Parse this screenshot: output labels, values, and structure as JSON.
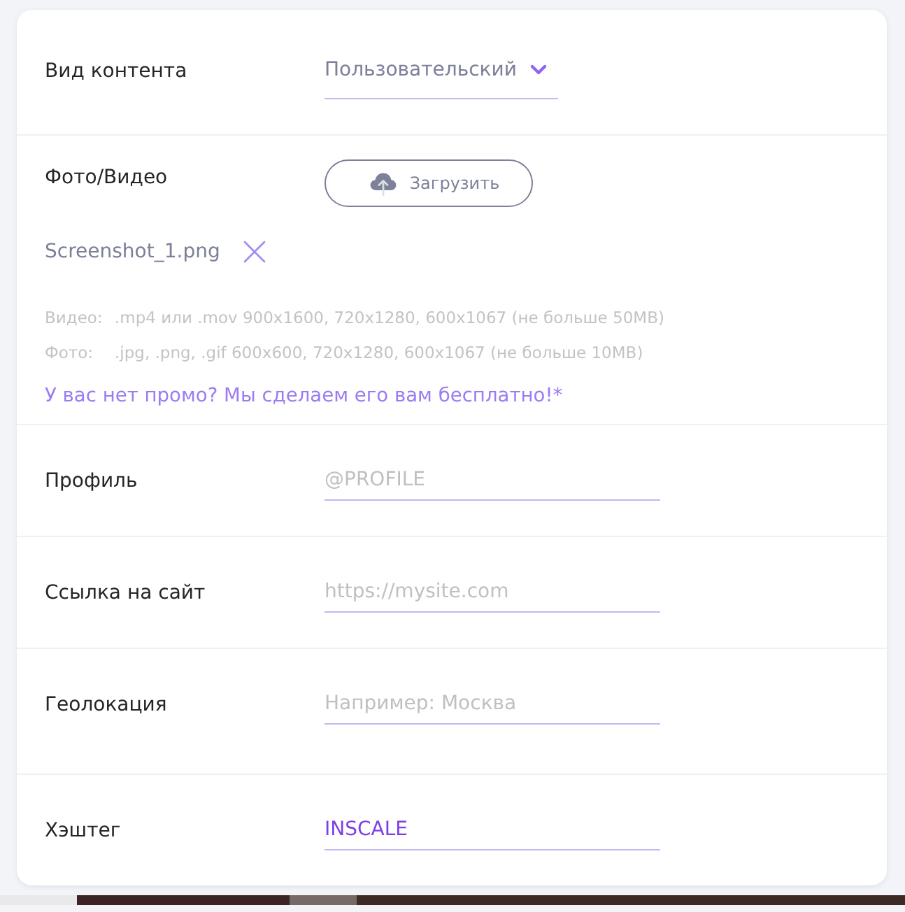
{
  "content_type": {
    "label": "Вид контента",
    "value": "Пользовательский"
  },
  "media": {
    "label": "Фото/Видео",
    "upload_button": "Загрузить",
    "file": {
      "name": "Screenshot_1.png"
    },
    "requirements": [
      {
        "label": "Видео:",
        "text": ".mp4 или .mov 900x1600, 720x1280, 600x1067 (не больше 50MB)"
      },
      {
        "label": "Фото:",
        "text": ".jpg, .png, .gif 600x600, 720x1280, 600x1067 (не больше 10MB)"
      }
    ],
    "promo_link": "У вас нет промо? Мы сделаем его вам бесплатно!*"
  },
  "fields": [
    {
      "label": "Профиль",
      "placeholder": "@PROFILE"
    },
    {
      "label": "Ссылка на сайт",
      "placeholder": "https://mysite.com"
    },
    {
      "label": "Геолокация",
      "placeholder": "Например: Москва"
    },
    {
      "label": "Хэштег",
      "value": "INSCALE"
    }
  ]
}
